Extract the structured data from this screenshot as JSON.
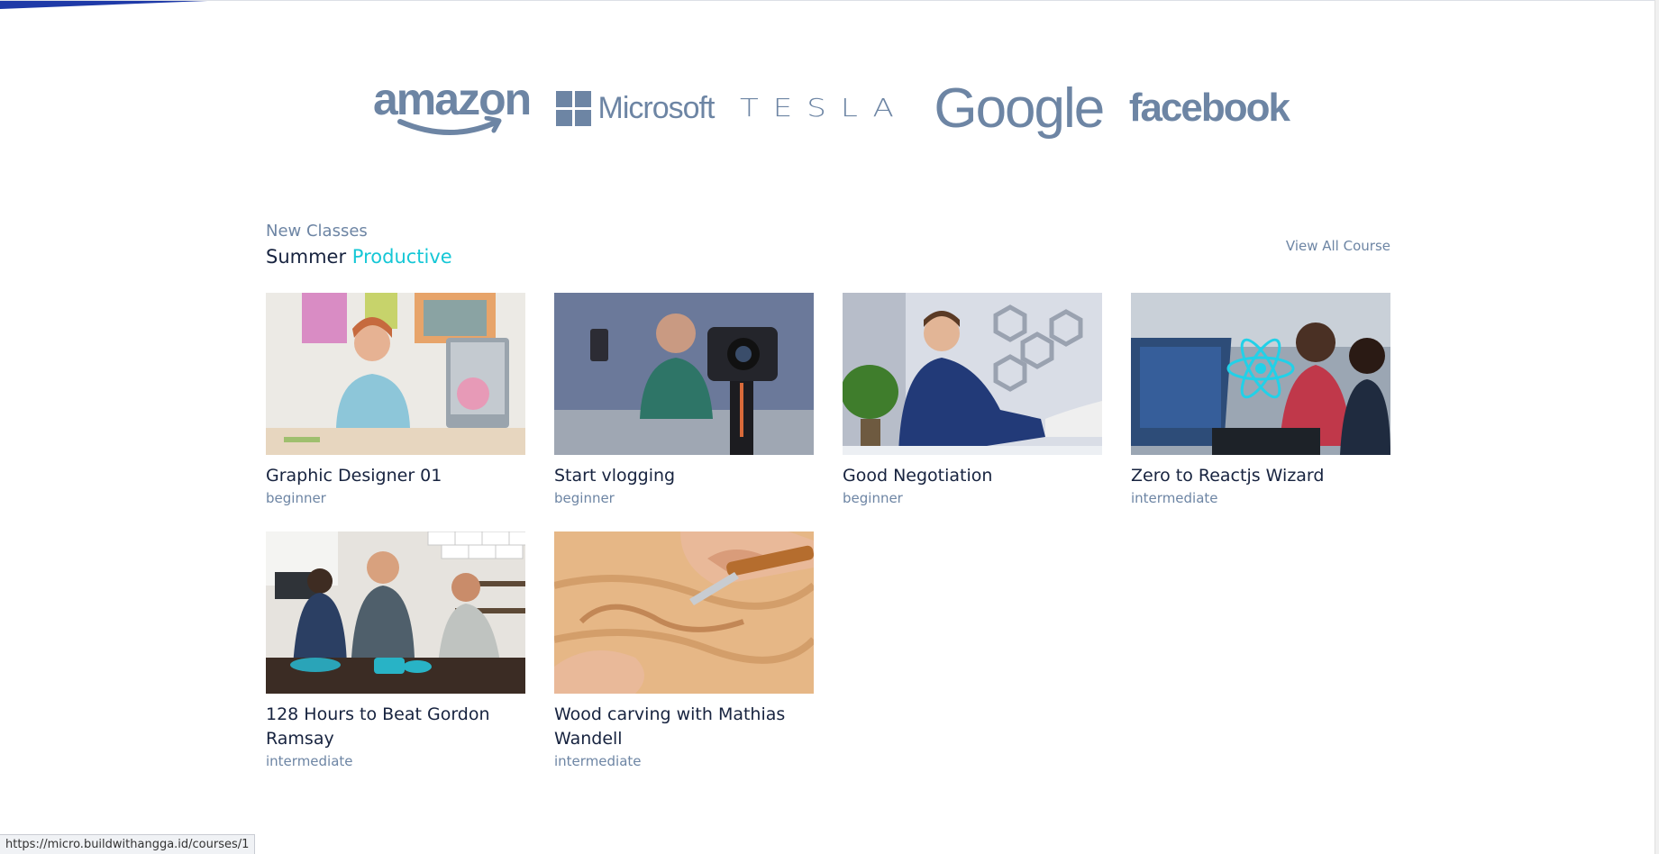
{
  "partners": {
    "amazon": "amazon",
    "microsoft": "Microsoft",
    "tesla": "TESLA",
    "google": "Google",
    "facebook": "facebook"
  },
  "section": {
    "eyebrow": "New Classes",
    "heading_prefix": "Summer",
    "heading_accent": "Productive",
    "view_all": "View All Course"
  },
  "courses": [
    {
      "title": "Graphic Designer 01",
      "level": "beginner"
    },
    {
      "title": "Start vlogging",
      "level": "beginner"
    },
    {
      "title": "Good Negotiation",
      "level": "beginner"
    },
    {
      "title": "Zero to Reactjs Wizard",
      "level": "intermediate"
    },
    {
      "title": "128 Hours to Beat Gordon Ramsay",
      "level": "intermediate"
    },
    {
      "title": "Wood carving with Mathias Wandell",
      "level": "intermediate"
    }
  ],
  "status_bar": {
    "url": "https://micro.buildwithangga.id/courses/1"
  },
  "colors": {
    "accent": "#16c7d6",
    "heading": "#17233f",
    "muted": "#6d85a4",
    "progress": "#1f3aa8"
  }
}
